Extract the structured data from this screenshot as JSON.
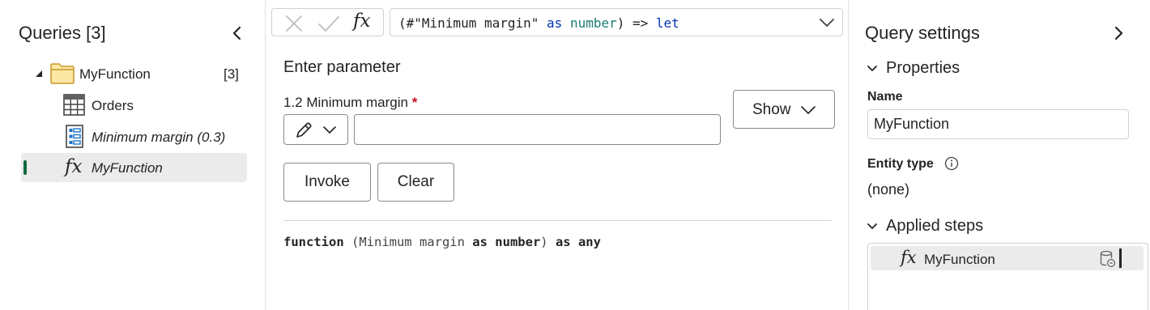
{
  "left_pane": {
    "title": "Queries [3]",
    "items": [
      {
        "label": "MyFunction",
        "count": "[3]",
        "icon": "folder-icon"
      },
      {
        "label": "Orders",
        "icon": "table-icon"
      },
      {
        "label": "Minimum margin (0.3)",
        "icon": "parameter-icon"
      },
      {
        "label": "MyFunction",
        "icon": "function-icon",
        "selected": true
      }
    ]
  },
  "formula_bar": {
    "formula": {
      "p1": "(#\"Minimum margin\" ",
      "kw1": "as",
      "sp": " ",
      "ty": "number",
      "p2": ") => ",
      "kw2": "let"
    }
  },
  "editor": {
    "heading": "Enter parameter",
    "param_label": "1.2 Minimum margin",
    "required_mark": "*",
    "param_value": "",
    "show_label": "Show",
    "invoke_label": "Invoke",
    "clear_label": "Clear",
    "signature": {
      "w1": "function",
      "p1": " (Minimum margin ",
      "w2": "as number",
      "p2": ") ",
      "w3": "as any"
    }
  },
  "query_settings": {
    "title": "Query settings",
    "properties_heading": "Properties",
    "name_label": "Name",
    "name_value": "MyFunction",
    "entity_label": "Entity type",
    "entity_value": "(none)",
    "applied_steps_heading": "Applied steps",
    "steps": [
      {
        "label": "MyFunction",
        "icon": "function-icon"
      }
    ]
  },
  "colors": {
    "selected_bar": "#0f6b3c",
    "keyword": "#0033b3",
    "type": "#1c7d6e",
    "required": "#c50f1f"
  }
}
